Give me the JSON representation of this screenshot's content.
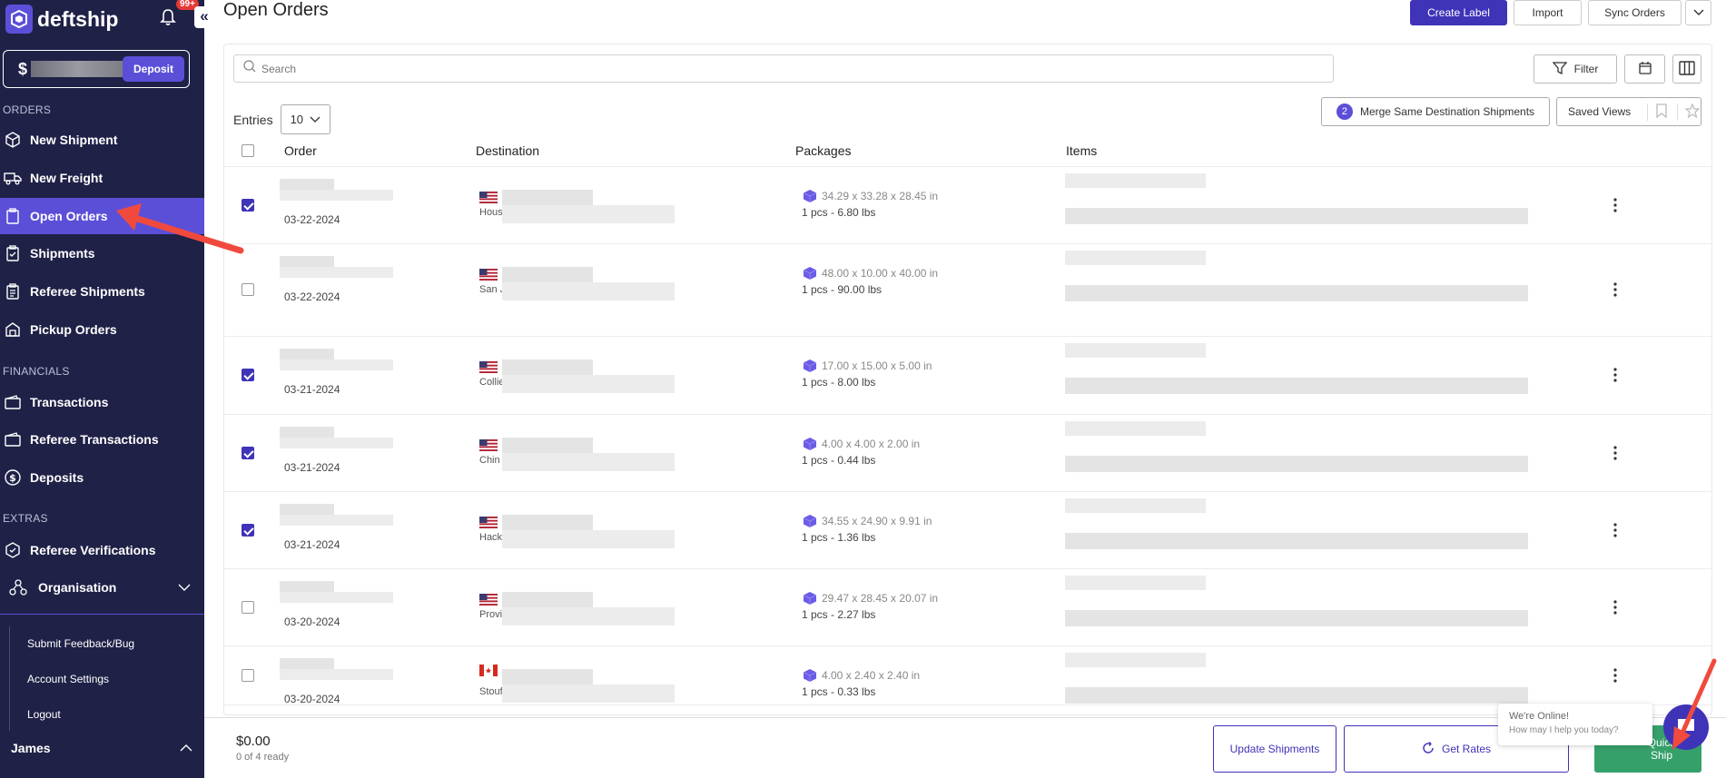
{
  "app": {
    "name": "deftship",
    "notif_count": "99+",
    "collapse": "«"
  },
  "balance": {
    "currency": "$",
    "deposit_label": "Deposit"
  },
  "sidebar": {
    "sections": {
      "orders": "ORDERS",
      "financials": "FINANCIALS",
      "extras": "EXTRAS"
    },
    "items": [
      {
        "label": "New Shipment",
        "icon": "box-icon"
      },
      {
        "label": "New Freight",
        "icon": "truck-icon"
      },
      {
        "label": "Open Orders",
        "icon": "clipboard-icon",
        "active": true
      },
      {
        "label": "Shipments",
        "icon": "clipboard-check-icon"
      },
      {
        "label": "Referee Shipments",
        "icon": "clipboard-list-icon"
      },
      {
        "label": "Pickup Orders",
        "icon": "pickup-icon"
      },
      {
        "label": "Transactions",
        "icon": "wallet-icon"
      },
      {
        "label": "Referee Transactions",
        "icon": "wallet-icon"
      },
      {
        "label": "Deposits",
        "icon": "dollar-icon"
      },
      {
        "label": "Referee Verifications",
        "icon": "verify-icon"
      }
    ],
    "organisation": "Organisation",
    "sub_items": [
      "Submit Feedback/Bug",
      "Account Settings",
      "Logout"
    ],
    "user": "James"
  },
  "page": {
    "title": "Open Orders",
    "buttons": {
      "create_label": "Create Label",
      "import": "Import",
      "sync_orders": "Sync Orders"
    },
    "search_placeholder": "Search",
    "filter_label": "Filter",
    "entries_label": "Entries",
    "entries_value": "10",
    "merge": {
      "count": "2",
      "label": "Merge Same Destination Shipments"
    },
    "saved_views": "Saved Views",
    "columns": [
      "Order",
      "Destination",
      "Packages",
      "Items"
    ]
  },
  "rows": [
    {
      "date": "03-22-2024",
      "checked": true,
      "flag": "us",
      "city": "Hous",
      "dims": "34.29 x 33.28 x 28.45 in",
      "pcs": "1 pcs - 6.80 lbs"
    },
    {
      "date": "03-22-2024",
      "checked": false,
      "flag": "us",
      "city": "San J",
      "dims": "48.00 x 10.00 x 40.00 in",
      "pcs": "1 pcs - 90.00 lbs"
    },
    {
      "date": "03-21-2024",
      "checked": true,
      "flag": "us",
      "city": "Collie",
      "dims": "17.00 x 15.00 x 5.00 in",
      "pcs": "1 pcs - 8.00 lbs"
    },
    {
      "date": "03-21-2024",
      "checked": true,
      "flag": "us",
      "city": "Chin",
      "dims": "4.00 x 4.00 x 2.00 in",
      "pcs": "1 pcs - 0.44 lbs"
    },
    {
      "date": "03-21-2024",
      "checked": true,
      "flag": "us",
      "city": "Hack",
      "dims": "34.55 x 24.90 x 9.91 in",
      "pcs": "1 pcs - 1.36 lbs"
    },
    {
      "date": "03-20-2024",
      "checked": false,
      "flag": "us",
      "city": "Provi",
      "dims": "29.47 x 28.45 x 20.07 in",
      "pcs": "1 pcs - 2.27 lbs"
    },
    {
      "date": "03-20-2024",
      "checked": false,
      "flag": "ca",
      "city": "Stouf",
      "dims": "4.00 x 2.40 x 2.40 in",
      "pcs": "1 pcs - 0.33 lbs"
    }
  ],
  "footer": {
    "total": "$0.00",
    "ready": "0 of 4 ready",
    "update": "Update Shipments",
    "get_rates": "Get Rates",
    "ship": "Quick Ship"
  },
  "chat": {
    "line1": "We're Online!",
    "line2": "How may I help you today?"
  },
  "colors": {
    "sidebar": "#1f2147",
    "accent": "#5b4fd8",
    "primary": "#3f33b8",
    "ship": "#36a06b"
  }
}
